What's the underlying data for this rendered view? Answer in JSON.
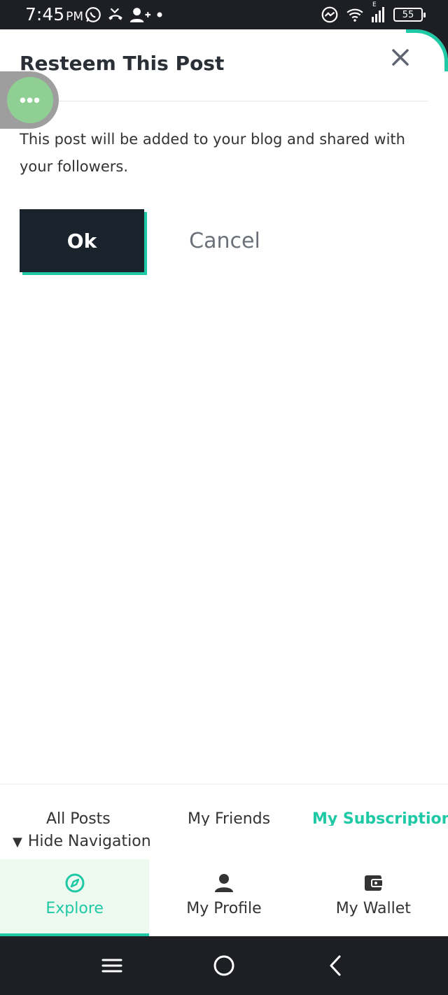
{
  "status_bar": {
    "time": "7:45",
    "ampm": "PM",
    "battery": "55",
    "network_label": "E"
  },
  "modal": {
    "title": "Resteem This Post",
    "message": "This post will be added to your blog and shared with your followers.",
    "ok_label": "Ok",
    "cancel_label": "Cancel"
  },
  "floating_menu": {
    "icon": "more-horizontal-icon",
    "glyph": "•••"
  },
  "feed_tabs": [
    {
      "label": "All Posts",
      "active": false
    },
    {
      "label": "My Friends",
      "active": false
    },
    {
      "label": "My Subscriptions",
      "active": true
    }
  ],
  "hide_navigation": {
    "glyph": "▼",
    "label": "Hide Navigation"
  },
  "bottom_nav": [
    {
      "label": "Explore",
      "icon": "compass-icon",
      "active": true
    },
    {
      "label": "My Profile",
      "icon": "user-icon",
      "active": false
    },
    {
      "label": "My Wallet",
      "icon": "wallet-icon",
      "active": false
    }
  ],
  "colors": {
    "accent": "#1fc9a6",
    "dark_button": "#1a222b",
    "status_bar": "#1d1f24",
    "explore_bg": "#eef9ef"
  }
}
